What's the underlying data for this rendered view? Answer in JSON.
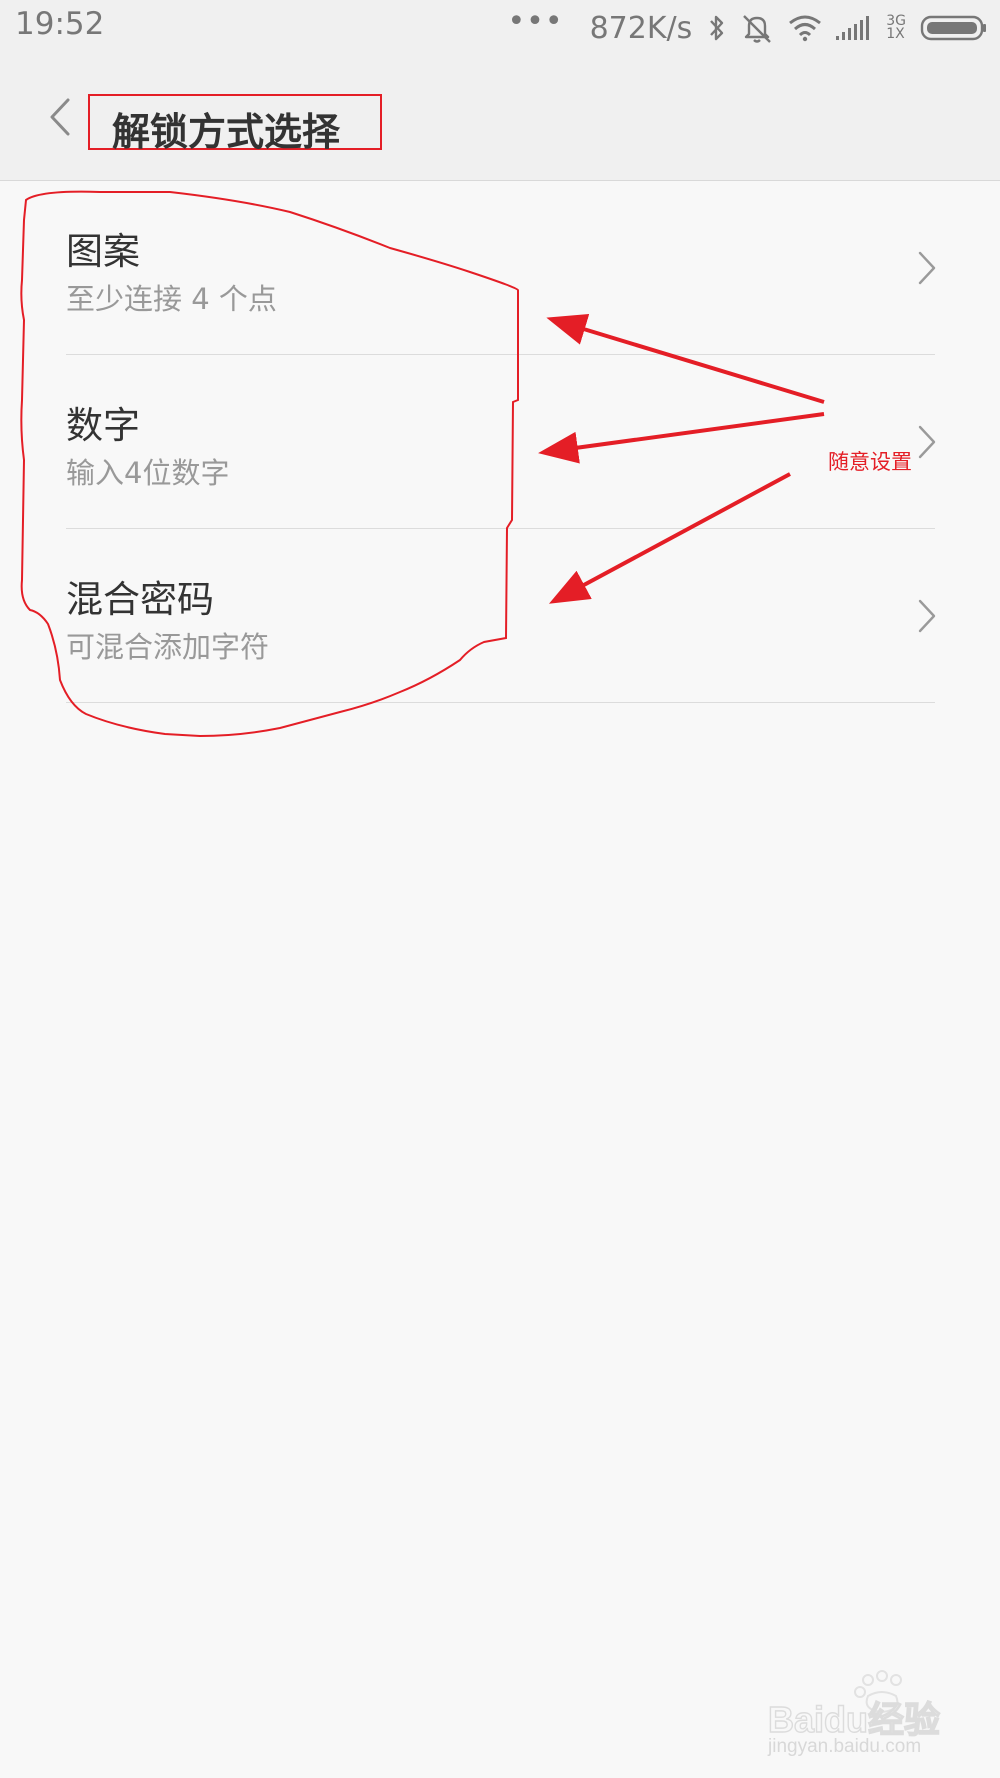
{
  "status_bar": {
    "time": "19:52",
    "dots": "•••",
    "net_speed": "872K/s",
    "net_type_top": "3G",
    "net_type_bottom": "1X",
    "icons": [
      "bluetooth-icon",
      "mute-icon",
      "wifi-icon",
      "signal-icon",
      "battery-icon"
    ]
  },
  "header": {
    "title": "解锁方式选择",
    "back_icon": "chevron-left-icon"
  },
  "lock_options": [
    {
      "title": "图案",
      "subtitle": "至少连接 4 个点"
    },
    {
      "title": "数字",
      "subtitle": "输入4位数字"
    },
    {
      "title": "混合密码",
      "subtitle": "可混合添加字符"
    }
  ],
  "annotation": {
    "label": "随意设置"
  },
  "watermark": {
    "brand": "Baidu经验",
    "url": "jingyan.baidu.com"
  },
  "colors": {
    "background": "#f8f8f8",
    "status_bar": "#f0f0f0",
    "annotation_red": "#e41e26",
    "title_text": "#333333",
    "subtitle_text": "#999999"
  }
}
